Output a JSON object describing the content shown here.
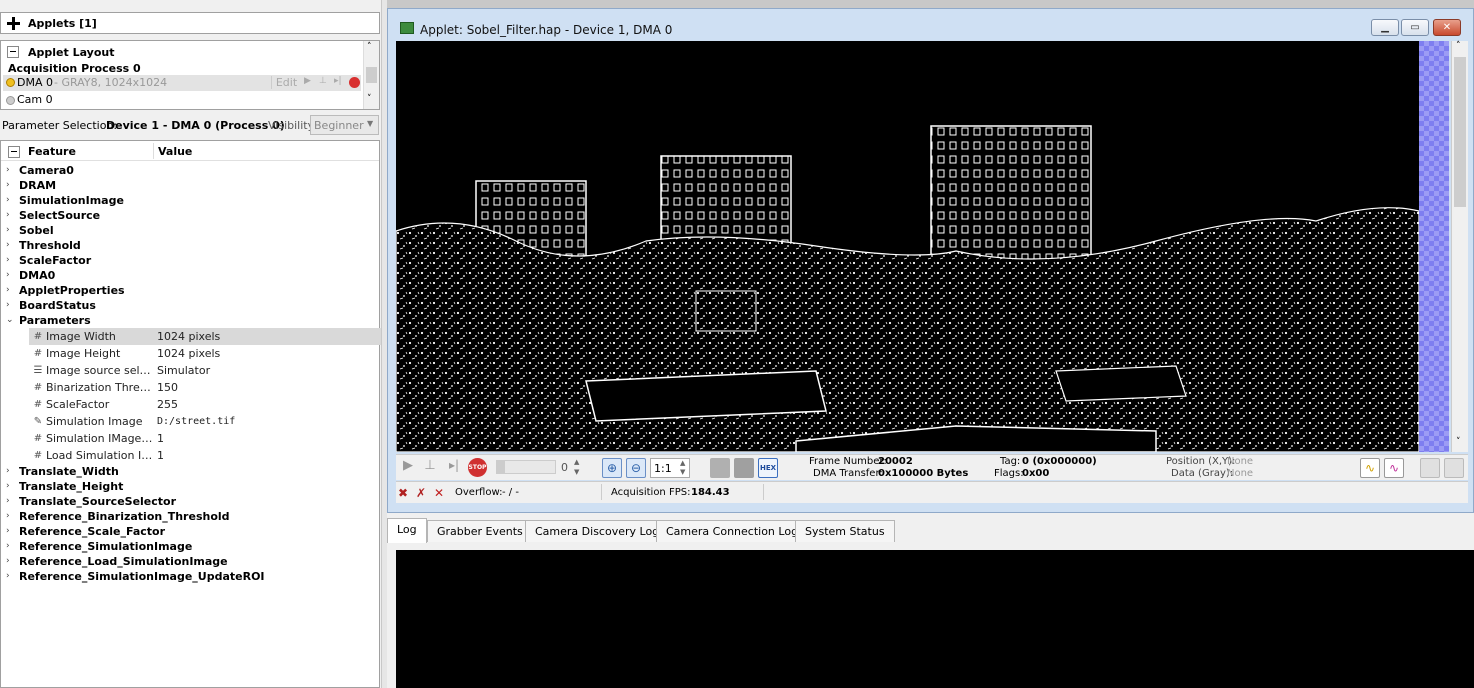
{
  "applets": {
    "header": "Applets [1]"
  },
  "applet_layout": {
    "title": "Applet Layout",
    "process": "Acquisition Process 0",
    "dma": {
      "name": "DMA 0",
      "format": " - GRAY8, 1024x1024",
      "edit": "Edit"
    },
    "cam": "Cam 0"
  },
  "param_selection": {
    "label": "Parameter Selection:",
    "value": "Device 1 - DMA 0 (Process 0)",
    "visibility_label": "Visibility:",
    "visibility_value": "Beginner"
  },
  "feature_table": {
    "col_feature": "Feature",
    "col_value": "Value",
    "groups_top": [
      "Camera0",
      "DRAM",
      "SimulationImage",
      "SelectSource",
      "Sobel",
      "Threshold",
      "ScaleFactor",
      "DMA0",
      "AppletProperties",
      "BoardStatus"
    ],
    "expanded_group": "Parameters",
    "params": [
      {
        "icon": "hash-icon",
        "name": "Image Width",
        "value": "1024 pixels"
      },
      {
        "icon": "hash-icon",
        "name": "Image Height",
        "value": "1024 pixels"
      },
      {
        "icon": "list-icon",
        "name": "Image source selec...",
        "value": "Simulator"
      },
      {
        "icon": "hash-icon",
        "name": "Binarization Thresh...",
        "value": "150"
      },
      {
        "icon": "hash-icon",
        "name": "ScaleFactor",
        "value": "255"
      },
      {
        "icon": "pencil-icon",
        "name": "Simulation Image",
        "value": "D:/street.tif"
      },
      {
        "icon": "hash-icon",
        "name": "Simulation IMage: ...",
        "value": "1"
      },
      {
        "icon": "hash-icon",
        "name": "Load Simulation Im...",
        "value": "1"
      }
    ],
    "groups_bottom": [
      "Translate_Width",
      "Translate_Height",
      "Translate_SourceSelector",
      "Reference_Binarization_Threshold",
      "Reference_Scale_Factor",
      "Reference_SimulationImage",
      "Reference_Load_SimulationImage",
      "Reference_SimulationImage_UpdateROI"
    ]
  },
  "applet_window": {
    "title": "Applet: Sobel_Filter.hap - Device 1, DMA 0",
    "toolbar": {
      "frame_spin": "0",
      "zoom_ratio": "1:1",
      "frame_number_label": "Frame Number:",
      "frame_number": "20002",
      "dma_transfer_label": "DMA Transfer:",
      "dma_transfer": "0x100000 Bytes",
      "tag_label": "Tag:",
      "tag": "0 (0x000000)",
      "flags_label": "Flags:",
      "flags": "0x00",
      "position_label": "Position (X,Y):",
      "position": "None",
      "data_label": "Data (Gray):",
      "data": "None",
      "hex": "HEX",
      "stop": "STOP"
    },
    "status": {
      "overflow_label": "Overflow:",
      "overflow": "- / -",
      "fps_label": "Acquisition FPS:",
      "fps": "184.43"
    }
  },
  "log_tabs": [
    "Log",
    "Grabber Events",
    "Camera Discovery Log",
    "Camera Connection Log",
    "System Status"
  ]
}
